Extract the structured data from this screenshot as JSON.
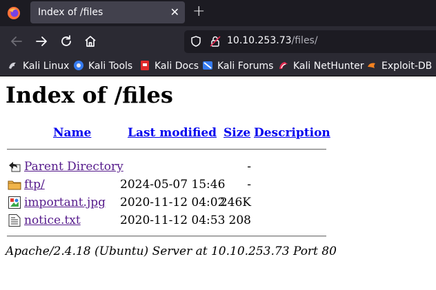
{
  "browser": {
    "tab_title": "Index of /files",
    "tab_close": "✕",
    "new_tab": "+",
    "url_host": "10.10.253.73",
    "url_path": "/files/",
    "bookmarks": [
      {
        "label": "Kali Linux",
        "icon": "kali-dragon-icon"
      },
      {
        "label": "Kali Tools",
        "icon": "kali-tools-icon"
      },
      {
        "label": "Kali Docs",
        "icon": "kali-docs-icon"
      },
      {
        "label": "Kali Forums",
        "icon": "kali-forums-icon"
      },
      {
        "label": "Kali NetHunter",
        "icon": "kali-nethunter-icon"
      },
      {
        "label": "Exploit-DB",
        "icon": "exploit-db-icon"
      }
    ]
  },
  "page": {
    "heading": "Index of /files",
    "columns": {
      "name": "Name",
      "modified": "Last modified",
      "size": "Size",
      "description": "Description"
    },
    "rows": [
      {
        "name": "Parent Directory",
        "modified": "",
        "size": "-",
        "icon": "back-arrow-icon"
      },
      {
        "name": "ftp/",
        "modified": "2024-05-07 15:46",
        "size": "-",
        "icon": "folder-icon"
      },
      {
        "name": "important.jpg",
        "modified": "2020-11-12 04:02",
        "size": "246K",
        "icon": "image-file-icon"
      },
      {
        "name": "notice.txt",
        "modified": "2020-11-12 04:53",
        "size": "208",
        "icon": "text-file-icon"
      }
    ],
    "footer": "Apache/2.4.18 (Ubuntu) Server at 10.10.253.73 Port 80"
  },
  "colors": {
    "link": "#0000ee",
    "visited_link": "#551a8b",
    "chrome_dark": "#1c1b22",
    "chrome": "#2b2a33"
  }
}
